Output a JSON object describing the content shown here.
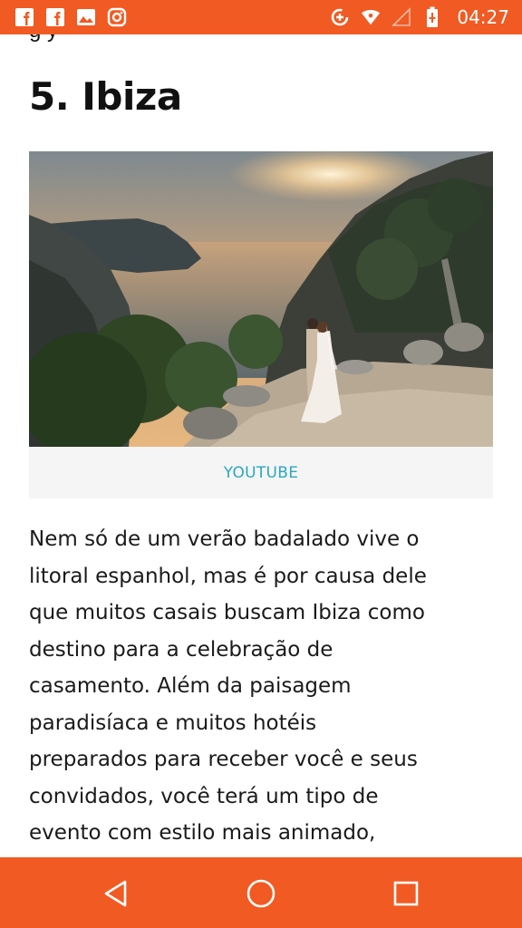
{
  "status_bar": {
    "time": "04:27",
    "left_icons": [
      "facebook-icon",
      "facebook-icon",
      "image-icon",
      "instagram-icon"
    ],
    "right_icons": [
      "data-saver-icon",
      "wifi-icon",
      "signal-icon",
      "battery-icon"
    ],
    "color": "#f15a22"
  },
  "article": {
    "cut_text": "g y",
    "heading": "5. Ibiza",
    "image_caption": "YOUTUBE",
    "paragraph_lines": [
      "Nem só de um verão badalado vive o",
      "litoral espanhol, mas é por causa dele",
      "que muitos casais buscam Ibiza como",
      "destino para a celebração de",
      "casamento. Além da paisagem",
      "paradisíaca e muitos hotéis",
      "preparados para receber você e seus",
      "convidados, você terá um tipo de",
      "evento com estilo mais animado,"
    ]
  },
  "nav_bar": {
    "buttons": [
      "back-icon",
      "home-icon",
      "recents-icon"
    ],
    "color": "#f15a22"
  }
}
